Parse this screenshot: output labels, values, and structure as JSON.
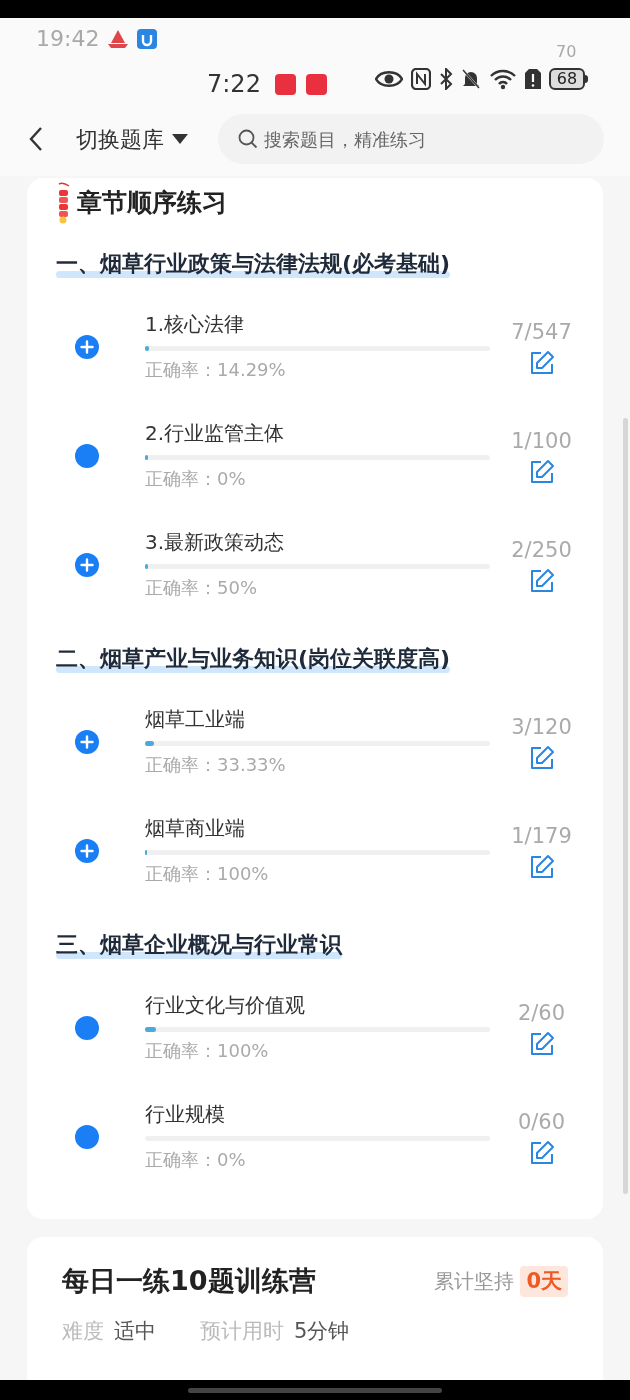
{
  "status_bar": {
    "ghost_time": "19:42",
    "ghost_battery": "70",
    "time": "7:22",
    "battery": "68"
  },
  "header": {
    "title": "切换题库",
    "search": {
      "placeholder": "搜索题目，精准练习"
    }
  },
  "chapter_card": {
    "title": "章节顺序练习",
    "sections": [
      {
        "title": "一、烟草行业政策与法律法规(必考基础)",
        "items": [
          {
            "kind": "expandable",
            "name": "1.核心法律",
            "level": 0.013,
            "accuracy": "正确率：14.29%",
            "count": "7/547"
          },
          {
            "kind": "leaf",
            "name": "2.行业监管主体",
            "level": 0.01,
            "accuracy": "正确率：0%",
            "count": "1/100"
          },
          {
            "kind": "expandable",
            "name": "3.最新政策动态",
            "level": 0.008,
            "accuracy": "正确率：50%",
            "count": "2/250"
          }
        ]
      },
      {
        "title": "二、烟草产业与业务知识(岗位关联度高)",
        "items": [
          {
            "kind": "expandable",
            "name": "烟草工业端",
            "level": 0.025,
            "accuracy": "正确率：33.33%",
            "count": "3/120"
          },
          {
            "kind": "expandable",
            "name": "烟草商业端",
            "level": 0.006,
            "accuracy": "正确率：100%",
            "count": "1/179"
          }
        ]
      },
      {
        "title": "三、烟草企业概况与行业常识",
        "items": [
          {
            "kind": "leaf",
            "name": "行业文化与价值观",
            "level": 0.033,
            "accuracy": "正确率：100%",
            "count": "2/60"
          },
          {
            "kind": "leaf",
            "name": "行业规模",
            "accuracy": "正确率：0%",
            "count": "0/60"
          }
        ]
      }
    ]
  },
  "daily_card": {
    "title": "每日一练10题训练营",
    "streak_label": "累计坚持",
    "streak_value": "0天",
    "difficulty_label": "难度",
    "difficulty_value": "适中",
    "time_label": "预计用时",
    "time_value": "5分钟"
  }
}
